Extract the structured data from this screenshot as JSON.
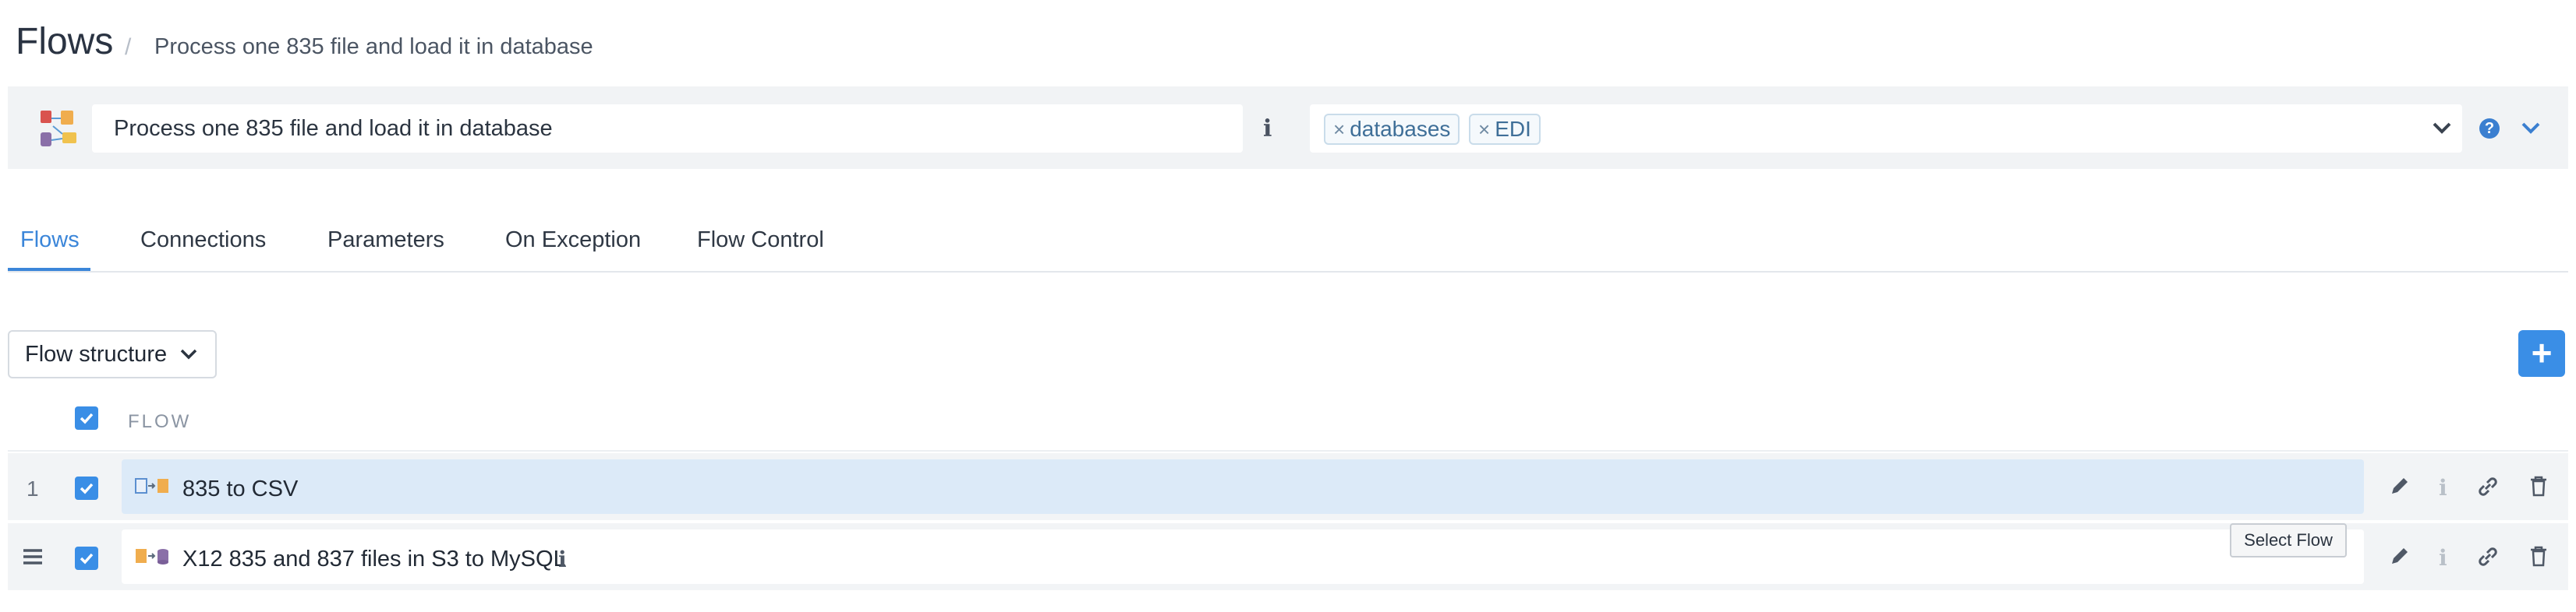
{
  "header": {
    "title": "Flows",
    "separator": "/",
    "breadcrumb": "Process one 835 file and load it in database"
  },
  "flow_bar": {
    "name_value": "Process one 835 file and load it in database",
    "info_symbol": "i",
    "tags": [
      {
        "label": "databases",
        "remove": "×"
      },
      {
        "label": "EDI",
        "remove": "×"
      }
    ],
    "help_symbol": "?"
  },
  "tabs": [
    {
      "label": "Flows",
      "active": true
    },
    {
      "label": "Connections",
      "active": false
    },
    {
      "label": "Parameters",
      "active": false
    },
    {
      "label": "On Exception",
      "active": false
    },
    {
      "label": "Flow Control",
      "active": false
    }
  ],
  "toolbar": {
    "view_select": "Flow structure",
    "add_symbol": "+"
  },
  "table": {
    "column_header": "FLOW",
    "rows": [
      {
        "index": "1",
        "name": "835 to CSV",
        "checked": true,
        "selected": true
      },
      {
        "index": "",
        "name": "X12 835 and 837 files in S3 to MySQL",
        "checked": true,
        "selected": false
      }
    ]
  },
  "tooltip": {
    "text": "Select Flow"
  },
  "colors": {
    "accent": "#3a8ee6",
    "tab_active": "#3b86d9",
    "selected_row": "#dceaf8",
    "bar_background": "#f1f3f5"
  },
  "icons": {
    "flow_logo": "flow-diagram-icon",
    "edit": "pencil-icon",
    "info": "info-icon",
    "link": "link-icon",
    "delete": "trash-icon",
    "drag": "drag-handle-icon",
    "dropdown": "chevron-down-icon",
    "help": "help-icon"
  }
}
